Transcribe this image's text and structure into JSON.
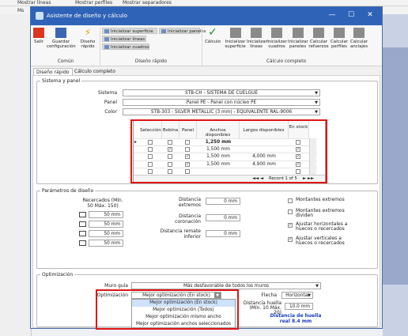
{
  "background": {
    "items": [
      "Mostrar líneas",
      "Mostrar perfiles",
      "Mostrar separadores",
      "Ms"
    ]
  },
  "window": {
    "title": "Asistente de diseño y cálculo",
    "min": "—",
    "max": "☐",
    "close": "✕"
  },
  "ribbon": {
    "salir": "Salir",
    "guardar": "Guardar configuración",
    "diseno_rapido": "Diseño rápido",
    "ini_superficie": "Inicializar superficie",
    "ini_paneles": "Inicializar paneles",
    "ini_lineas": "Inicializar líneas",
    "ini_cuadros": "Inicializar cuadros",
    "calculo": "Cálculo",
    "calc_buttons": [
      "Inicializar superficie",
      "Inicializar líneas",
      "Inicializar cuadros",
      "Inicializar paneles",
      "Calcular refuerzos",
      "Calcular perfiles",
      "Calcular anclajes"
    ],
    "groups": {
      "comun": "Común",
      "diseno": "Diseño rápido",
      "calculo": "Cálculo completo"
    }
  },
  "tabs": [
    "Diseño rápido",
    "Cálculo completo"
  ],
  "sistema_panel": {
    "legend": "Sistema y panel",
    "sistema_label": "Sistema",
    "sistema_value": "STB-CH - SISTEMA DE CUELGUE",
    "panel_label": "Panel",
    "panel_value": "Panel PE - Panel con núcleo PE",
    "color_label": "Color",
    "color_value": "STB-303 - SILVER METALLIC (3 mm) - EQUIVALENTE RAL-9006"
  },
  "grid": {
    "headers": [
      "Selección",
      "Bobina",
      "Panel",
      "Anchos disponibles",
      "Largos disponibles",
      "En stock"
    ],
    "rows": [
      {
        "seleccion": false,
        "bobina": false,
        "panel": false,
        "ancho": "1,250 mm",
        "largo": "",
        "stock": false
      },
      {
        "seleccion": false,
        "bobina": true,
        "panel": false,
        "ancho": "1,500 mm",
        "largo": "",
        "stock": true
      },
      {
        "seleccion": false,
        "bobina": false,
        "panel": true,
        "ancho": "1,500 mm",
        "largo": "4,000 mm",
        "stock": true
      },
      {
        "seleccion": false,
        "bobina": false,
        "panel": true,
        "ancho": "1,500 mm",
        "largo": "4,900 mm",
        "stock": true
      },
      {
        "seleccion": false,
        "bobina": false,
        "panel": false,
        "ancho": "",
        "largo": "",
        "stock": false
      }
    ],
    "record": "Record 1 of 5"
  },
  "params": {
    "legend": "Parámetros de diseño",
    "recercados_label": "Recercados (Mín. 50 Máx. 150)",
    "recercados": [
      "50 mm",
      "50 mm",
      "50 mm",
      "50 mm"
    ],
    "dist_extremos_label": "Distancia extremos",
    "dist_extremos": "0 mm",
    "dist_coronacion_label": "Distancia coronación",
    "dist_coronacion": "0 mm",
    "dist_remate_label": "Distancia remate inferior",
    "dist_remate": "0 mm",
    "checks": [
      {
        "label": "Montantes extremos",
        "checked": false
      },
      {
        "label": "Montantes extremos dividen",
        "checked": false
      },
      {
        "label": "Ajustar horizontales a huecos o recercados",
        "checked": true
      },
      {
        "label": "Ajustar verticales a huecos o recercados",
        "checked": true
      }
    ]
  },
  "optim": {
    "legend": "Optimización",
    "muro_label": "Muro guía",
    "muro_value": "Más desfavorable de todos los muros",
    "optim_label": "Optimización",
    "optim_value": "Mejor optimización (En stock)",
    "options": [
      "Mejor optimización (En stock)",
      "Mejor optimización (Todos)",
      "Mejor optimización mismo ancho",
      "Mejor optimización anchos seleccionados"
    ],
    "flecha_label": "Flecha",
    "flecha_value": "Horizontal",
    "huella_label": "Distancia huella (Mín. 10 Máx. 20)",
    "huella_value": "10.0 mm",
    "huella_real": "Distancia de huella real 8.4 mm"
  }
}
